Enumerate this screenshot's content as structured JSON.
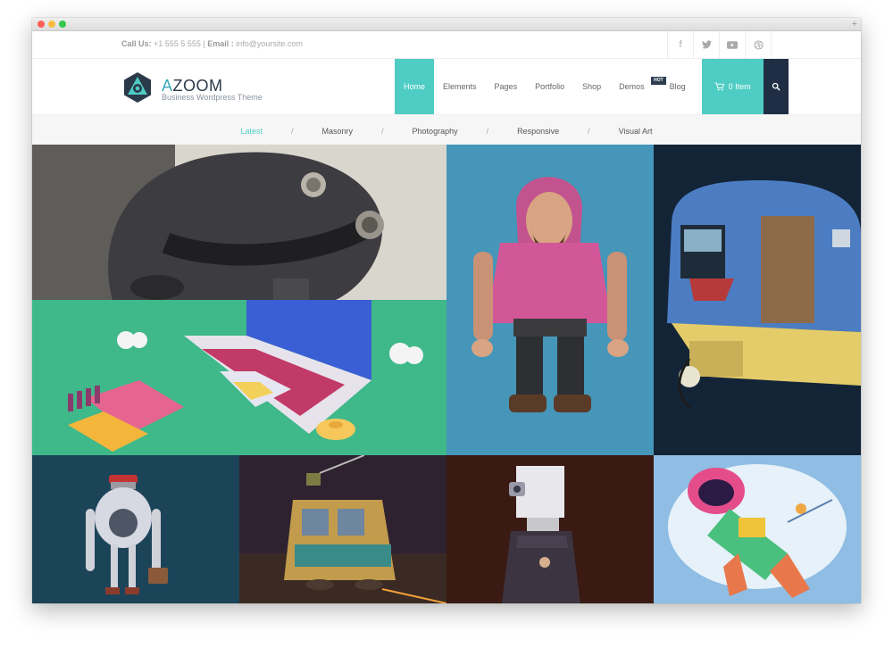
{
  "topbar": {
    "call_label": "Call Us:",
    "phone": "+1 555 5 555",
    "separator": "|",
    "email_label": "Email :",
    "email": "info@yoursite.com"
  },
  "socials": [
    {
      "icon": "facebook-icon",
      "glyph": "f"
    },
    {
      "icon": "twitter-icon",
      "glyph": "🐦"
    },
    {
      "icon": "youtube-icon",
      "glyph": "▶"
    },
    {
      "icon": "dribbble-icon",
      "glyph": "◎"
    }
  ],
  "brand": {
    "name_first": "A",
    "name_rest": "ZOOM",
    "tagline": "Business Wordpress Theme"
  },
  "nav": {
    "items": [
      "Home",
      "Elements",
      "Pages",
      "Portfolio",
      "Shop",
      "Demos",
      "Blog"
    ],
    "hot_badge": "HOT",
    "cart_label": "0 Item",
    "active": "Home"
  },
  "filters": {
    "items": [
      "Latest",
      "Masonry",
      "Photography",
      "Responsive",
      "Visual Art"
    ],
    "separator": "/",
    "active": "Latest"
  },
  "colors": {
    "accent": "#4fcdc4",
    "dark": "#1f2e44"
  },
  "window": {
    "new_tab": "+"
  }
}
